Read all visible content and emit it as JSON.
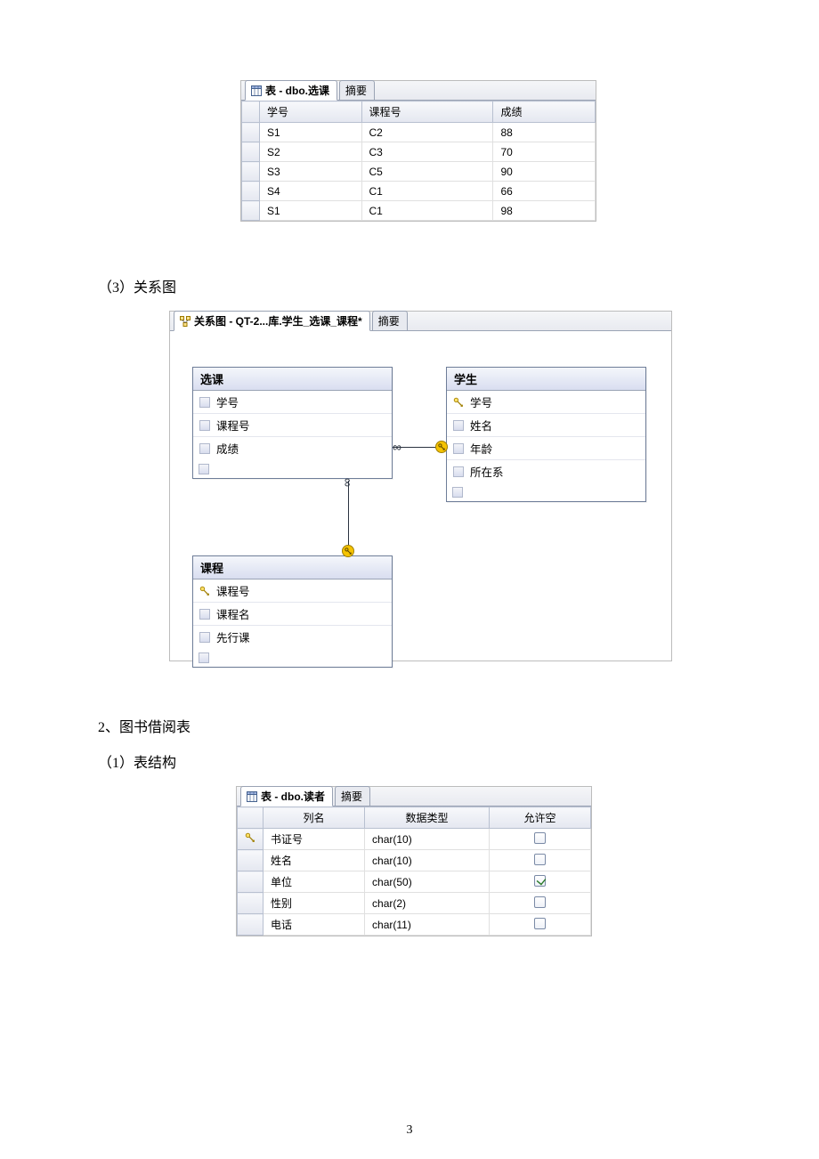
{
  "table1": {
    "tabs": {
      "active": "表 - dbo.选课",
      "inactive": "摘要"
    },
    "headers": [
      "学号",
      "课程号",
      "成绩"
    ],
    "rows": [
      [
        "S1",
        "C2",
        "88"
      ],
      [
        "S2",
        "C3",
        "70"
      ],
      [
        "S3",
        "C5",
        "90"
      ],
      [
        "S4",
        "C1",
        "66"
      ],
      [
        "S1",
        "C1",
        "98"
      ]
    ]
  },
  "sections": {
    "s3_label": "（3）关系图",
    "s2_label": "2、图书借阅表",
    "s2_1_label": "（1）表结构"
  },
  "diagram": {
    "tabs": {
      "active": "关系图 - QT-2...库.学生_选课_课程*",
      "inactive": "摘要"
    },
    "tables": {
      "xuanke": {
        "title": "选课",
        "cols": [
          {
            "name": "学号",
            "pk": false
          },
          {
            "name": "课程号",
            "pk": false
          },
          {
            "name": "成绩",
            "pk": false
          }
        ]
      },
      "xuesheng": {
        "title": "学生",
        "cols": [
          {
            "name": "学号",
            "pk": true
          },
          {
            "name": "姓名",
            "pk": false
          },
          {
            "name": "年龄",
            "pk": false
          },
          {
            "name": "所在系",
            "pk": false
          }
        ]
      },
      "kecheng": {
        "title": "课程",
        "cols": [
          {
            "name": "课程号",
            "pk": true
          },
          {
            "name": "课程名",
            "pk": false
          },
          {
            "name": "先行课",
            "pk": false
          }
        ]
      }
    }
  },
  "table3": {
    "tabs": {
      "active": "表 - dbo.读者",
      "inactive": "摘要"
    },
    "headers": [
      "列名",
      "数据类型",
      "允许空"
    ],
    "rows": [
      {
        "pk": true,
        "name": "书证号",
        "type": "char(10)",
        "nullable": false
      },
      {
        "pk": false,
        "name": "姓名",
        "type": "char(10)",
        "nullable": false
      },
      {
        "pk": false,
        "name": "单位",
        "type": "char(50)",
        "nullable": true
      },
      {
        "pk": false,
        "name": "性别",
        "type": "char(2)",
        "nullable": false
      },
      {
        "pk": false,
        "name": "电话",
        "type": "char(11)",
        "nullable": false
      }
    ]
  },
  "page_number": "3"
}
